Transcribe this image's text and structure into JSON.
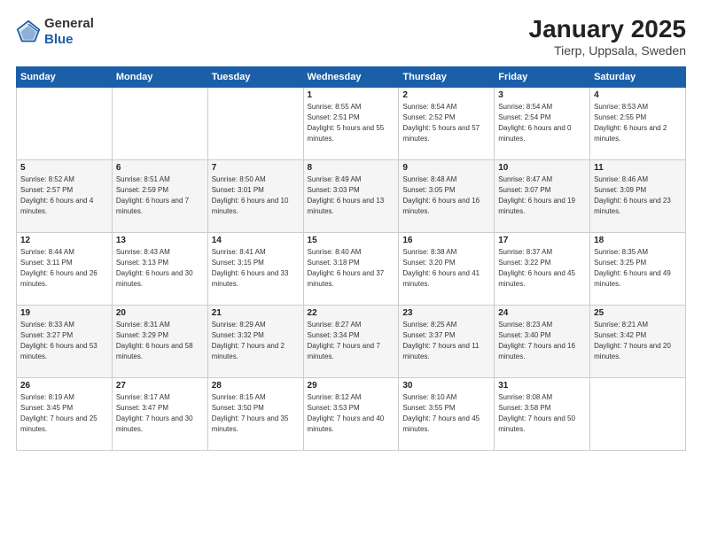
{
  "logo": {
    "general": "General",
    "blue": "Blue"
  },
  "title": "January 2025",
  "subtitle": "Tierp, Uppsala, Sweden",
  "weekdays": [
    "Sunday",
    "Monday",
    "Tuesday",
    "Wednesday",
    "Thursday",
    "Friday",
    "Saturday"
  ],
  "weeks": [
    [
      {
        "day": "",
        "sunrise": "",
        "sunset": "",
        "daylight": ""
      },
      {
        "day": "",
        "sunrise": "",
        "sunset": "",
        "daylight": ""
      },
      {
        "day": "",
        "sunrise": "",
        "sunset": "",
        "daylight": ""
      },
      {
        "day": "1",
        "sunrise": "Sunrise: 8:55 AM",
        "sunset": "Sunset: 2:51 PM",
        "daylight": "Daylight: 5 hours and 55 minutes."
      },
      {
        "day": "2",
        "sunrise": "Sunrise: 8:54 AM",
        "sunset": "Sunset: 2:52 PM",
        "daylight": "Daylight: 5 hours and 57 minutes."
      },
      {
        "day": "3",
        "sunrise": "Sunrise: 8:54 AM",
        "sunset": "Sunset: 2:54 PM",
        "daylight": "Daylight: 6 hours and 0 minutes."
      },
      {
        "day": "4",
        "sunrise": "Sunrise: 8:53 AM",
        "sunset": "Sunset: 2:55 PM",
        "daylight": "Daylight: 6 hours and 2 minutes."
      }
    ],
    [
      {
        "day": "5",
        "sunrise": "Sunrise: 8:52 AM",
        "sunset": "Sunset: 2:57 PM",
        "daylight": "Daylight: 6 hours and 4 minutes."
      },
      {
        "day": "6",
        "sunrise": "Sunrise: 8:51 AM",
        "sunset": "Sunset: 2:59 PM",
        "daylight": "Daylight: 6 hours and 7 minutes."
      },
      {
        "day": "7",
        "sunrise": "Sunrise: 8:50 AM",
        "sunset": "Sunset: 3:01 PM",
        "daylight": "Daylight: 6 hours and 10 minutes."
      },
      {
        "day": "8",
        "sunrise": "Sunrise: 8:49 AM",
        "sunset": "Sunset: 3:03 PM",
        "daylight": "Daylight: 6 hours and 13 minutes."
      },
      {
        "day": "9",
        "sunrise": "Sunrise: 8:48 AM",
        "sunset": "Sunset: 3:05 PM",
        "daylight": "Daylight: 6 hours and 16 minutes."
      },
      {
        "day": "10",
        "sunrise": "Sunrise: 8:47 AM",
        "sunset": "Sunset: 3:07 PM",
        "daylight": "Daylight: 6 hours and 19 minutes."
      },
      {
        "day": "11",
        "sunrise": "Sunrise: 8:46 AM",
        "sunset": "Sunset: 3:09 PM",
        "daylight": "Daylight: 6 hours and 23 minutes."
      }
    ],
    [
      {
        "day": "12",
        "sunrise": "Sunrise: 8:44 AM",
        "sunset": "Sunset: 3:11 PM",
        "daylight": "Daylight: 6 hours and 26 minutes."
      },
      {
        "day": "13",
        "sunrise": "Sunrise: 8:43 AM",
        "sunset": "Sunset: 3:13 PM",
        "daylight": "Daylight: 6 hours and 30 minutes."
      },
      {
        "day": "14",
        "sunrise": "Sunrise: 8:41 AM",
        "sunset": "Sunset: 3:15 PM",
        "daylight": "Daylight: 6 hours and 33 minutes."
      },
      {
        "day": "15",
        "sunrise": "Sunrise: 8:40 AM",
        "sunset": "Sunset: 3:18 PM",
        "daylight": "Daylight: 6 hours and 37 minutes."
      },
      {
        "day": "16",
        "sunrise": "Sunrise: 8:38 AM",
        "sunset": "Sunset: 3:20 PM",
        "daylight": "Daylight: 6 hours and 41 minutes."
      },
      {
        "day": "17",
        "sunrise": "Sunrise: 8:37 AM",
        "sunset": "Sunset: 3:22 PM",
        "daylight": "Daylight: 6 hours and 45 minutes."
      },
      {
        "day": "18",
        "sunrise": "Sunrise: 8:35 AM",
        "sunset": "Sunset: 3:25 PM",
        "daylight": "Daylight: 6 hours and 49 minutes."
      }
    ],
    [
      {
        "day": "19",
        "sunrise": "Sunrise: 8:33 AM",
        "sunset": "Sunset: 3:27 PM",
        "daylight": "Daylight: 6 hours and 53 minutes."
      },
      {
        "day": "20",
        "sunrise": "Sunrise: 8:31 AM",
        "sunset": "Sunset: 3:29 PM",
        "daylight": "Daylight: 6 hours and 58 minutes."
      },
      {
        "day": "21",
        "sunrise": "Sunrise: 8:29 AM",
        "sunset": "Sunset: 3:32 PM",
        "daylight": "Daylight: 7 hours and 2 minutes."
      },
      {
        "day": "22",
        "sunrise": "Sunrise: 8:27 AM",
        "sunset": "Sunset: 3:34 PM",
        "daylight": "Daylight: 7 hours and 7 minutes."
      },
      {
        "day": "23",
        "sunrise": "Sunrise: 8:25 AM",
        "sunset": "Sunset: 3:37 PM",
        "daylight": "Daylight: 7 hours and 11 minutes."
      },
      {
        "day": "24",
        "sunrise": "Sunrise: 8:23 AM",
        "sunset": "Sunset: 3:40 PM",
        "daylight": "Daylight: 7 hours and 16 minutes."
      },
      {
        "day": "25",
        "sunrise": "Sunrise: 8:21 AM",
        "sunset": "Sunset: 3:42 PM",
        "daylight": "Daylight: 7 hours and 20 minutes."
      }
    ],
    [
      {
        "day": "26",
        "sunrise": "Sunrise: 8:19 AM",
        "sunset": "Sunset: 3:45 PM",
        "daylight": "Daylight: 7 hours and 25 minutes."
      },
      {
        "day": "27",
        "sunrise": "Sunrise: 8:17 AM",
        "sunset": "Sunset: 3:47 PM",
        "daylight": "Daylight: 7 hours and 30 minutes."
      },
      {
        "day": "28",
        "sunrise": "Sunrise: 8:15 AM",
        "sunset": "Sunset: 3:50 PM",
        "daylight": "Daylight: 7 hours and 35 minutes."
      },
      {
        "day": "29",
        "sunrise": "Sunrise: 8:12 AM",
        "sunset": "Sunset: 3:53 PM",
        "daylight": "Daylight: 7 hours and 40 minutes."
      },
      {
        "day": "30",
        "sunrise": "Sunrise: 8:10 AM",
        "sunset": "Sunset: 3:55 PM",
        "daylight": "Daylight: 7 hours and 45 minutes."
      },
      {
        "day": "31",
        "sunrise": "Sunrise: 8:08 AM",
        "sunset": "Sunset: 3:58 PM",
        "daylight": "Daylight: 7 hours and 50 minutes."
      },
      {
        "day": "",
        "sunrise": "",
        "sunset": "",
        "daylight": ""
      }
    ]
  ]
}
